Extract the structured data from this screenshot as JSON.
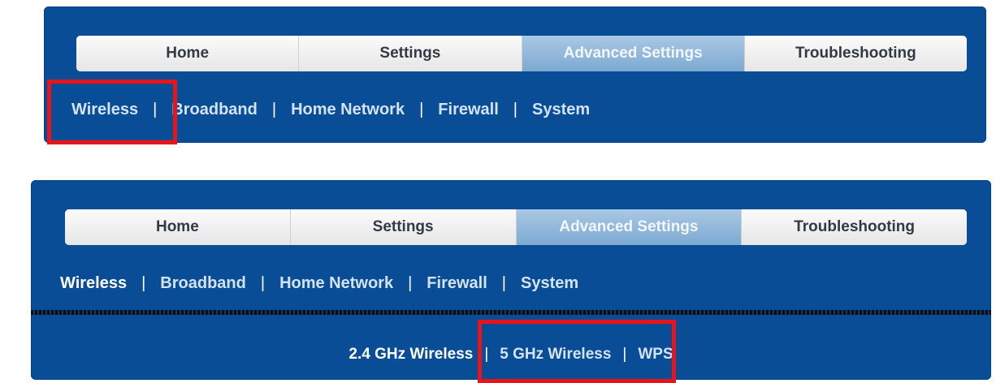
{
  "panel_top": {
    "tabs": [
      {
        "label": "Home"
      },
      {
        "label": "Settings"
      },
      {
        "label": "Advanced Settings",
        "active": true
      },
      {
        "label": "Troubleshooting"
      }
    ],
    "subnav": [
      "Wireless",
      "Broadband",
      "Home Network",
      "Firewall",
      "System"
    ],
    "separator": "|"
  },
  "panel_bottom": {
    "tabs": [
      {
        "label": "Home"
      },
      {
        "label": "Settings"
      },
      {
        "label": "Advanced Settings",
        "active": true
      },
      {
        "label": "Troubleshooting"
      }
    ],
    "subnav": [
      "Wireless",
      "Broadband",
      "Home Network",
      "Firewall",
      "System"
    ],
    "current_subnav": "Wireless",
    "wireless_subnav": [
      "2.4 GHz Wireless",
      "5 GHz Wireless",
      "WPS"
    ],
    "current_wireless": "2.4 GHz Wireless",
    "separator": "|"
  },
  "colors": {
    "panel_bg": "#0a4d97",
    "highlight": "#e8141b",
    "active_tab": "#8fb5db"
  }
}
